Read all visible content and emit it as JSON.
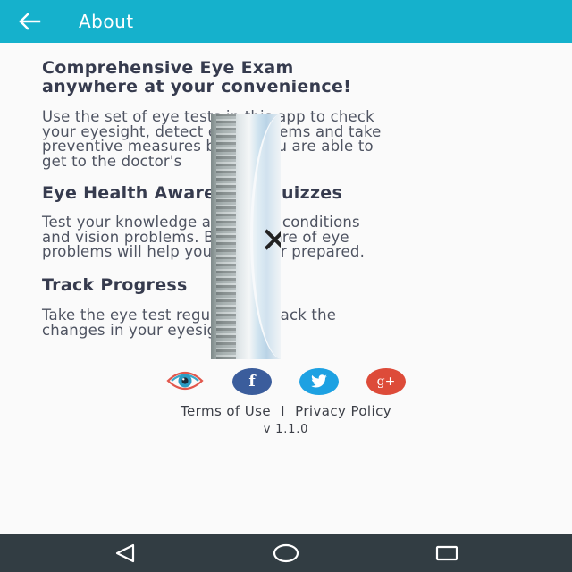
{
  "appbar": {
    "title": "About",
    "background": "#15b1cc",
    "back_icon": "arrow-left-icon"
  },
  "sections": [
    {
      "title_line1": "Comprehensive Eye Exam",
      "title_line2": "anywhere at your convenience!",
      "body_lines": [
        "Use the set of eye tests in this app to check",
        "your eyesight, detect eye problems and take",
        "preventive measures before you are able to",
        "get to the doctor's"
      ]
    },
    {
      "title": "Eye Health Awareness Quizzes",
      "body_lines": [
        "Test your knowledge about eye conditions",
        "and vision problems. Being aware of eye",
        "problems will help you be better prepared."
      ]
    },
    {
      "title": "Track Progress",
      "body_lines": [
        "Take the eye test regularly to track the",
        "changes in your eyesight."
      ]
    }
  ],
  "social": {
    "app_icon": "eye-app-icon",
    "facebook_glyph": "f",
    "facebook_color": "#3b5d9c",
    "twitter_icon": "twitter-bird-icon",
    "twitter_color": "#1da1e2",
    "googleplus_glyph": "g+",
    "googleplus_color": "#dd4b39"
  },
  "links": {
    "terms": "Terms of Use",
    "separator": "I",
    "privacy": "Privacy Policy"
  },
  "version": "v 1.1.0",
  "navbar": {
    "background": "#323d43",
    "back_icon": "nav-back-triangle-icon",
    "home_icon": "nav-home-circle-icon",
    "recent_icon": "nav-recents-square-icon"
  }
}
